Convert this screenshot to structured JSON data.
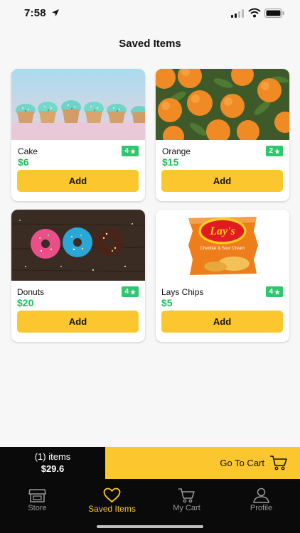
{
  "status_bar": {
    "time": "7:58"
  },
  "page": {
    "title": "Saved Items"
  },
  "items": [
    {
      "name": "Cake",
      "rating": "4",
      "price": "$6",
      "button": "Add",
      "image": "cupcakes-photo"
    },
    {
      "name": "Orange",
      "rating": "2",
      "price": "$15",
      "button": "Add",
      "image": "oranges-photo"
    },
    {
      "name": "Donuts",
      "rating": "4",
      "price": "$20",
      "button": "Add",
      "image": "donuts-photo"
    },
    {
      "name": "Lays Chips",
      "rating": "4",
      "price": "$5",
      "button": "Add",
      "image": "chips-bag-photo"
    }
  ],
  "product_logo": {
    "brand": "Lay's",
    "flavor": "Cheddar & Sour Cream"
  },
  "cart_bar": {
    "count": "(1) items",
    "total": "$29.6",
    "action": "Go To Cart"
  },
  "tabs": [
    {
      "label": "Store",
      "icon": "store-icon",
      "active": false
    },
    {
      "label": "Saved Items",
      "icon": "heart-icon",
      "active": true
    },
    {
      "label": "My Cart",
      "icon": "cart-icon",
      "active": false
    },
    {
      "label": "Profile",
      "icon": "profile-icon",
      "active": false
    }
  ],
  "colors": {
    "accent": "#fcc72e",
    "price": "#1fbf5b",
    "rating_badge": "#2ec76e",
    "bar_dark": "#0a0a0a"
  }
}
